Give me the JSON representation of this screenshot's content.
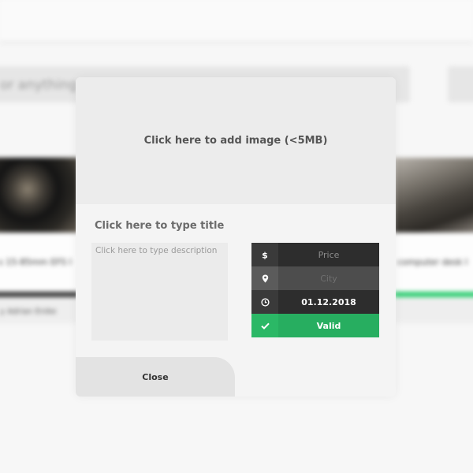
{
  "background": {
    "search_placeholder": "or anything",
    "cards": [
      {
        "title": "s 15-85mm EFS I",
        "author": "y Adrian Enike"
      },
      {
        "title": "computer desk I"
      }
    ]
  },
  "modal": {
    "image_upload_label": "Click here to add image (<5MB)",
    "title_placeholder": "Click here to type title",
    "description_placeholder": "Click here to type description",
    "fields": {
      "price": {
        "icon": "dollar-icon",
        "placeholder": "Price"
      },
      "city": {
        "icon": "map-pin-icon",
        "placeholder": "City"
      },
      "date": {
        "icon": "clock-icon",
        "value": "01.12.2018"
      },
      "valid": {
        "icon": "check-icon",
        "label": "Valid"
      }
    },
    "close_label": "Close"
  },
  "colors": {
    "accent_green": "#27ae60",
    "dark_row": "#2d2d2d",
    "modal_bg": "#f4f4f4"
  }
}
